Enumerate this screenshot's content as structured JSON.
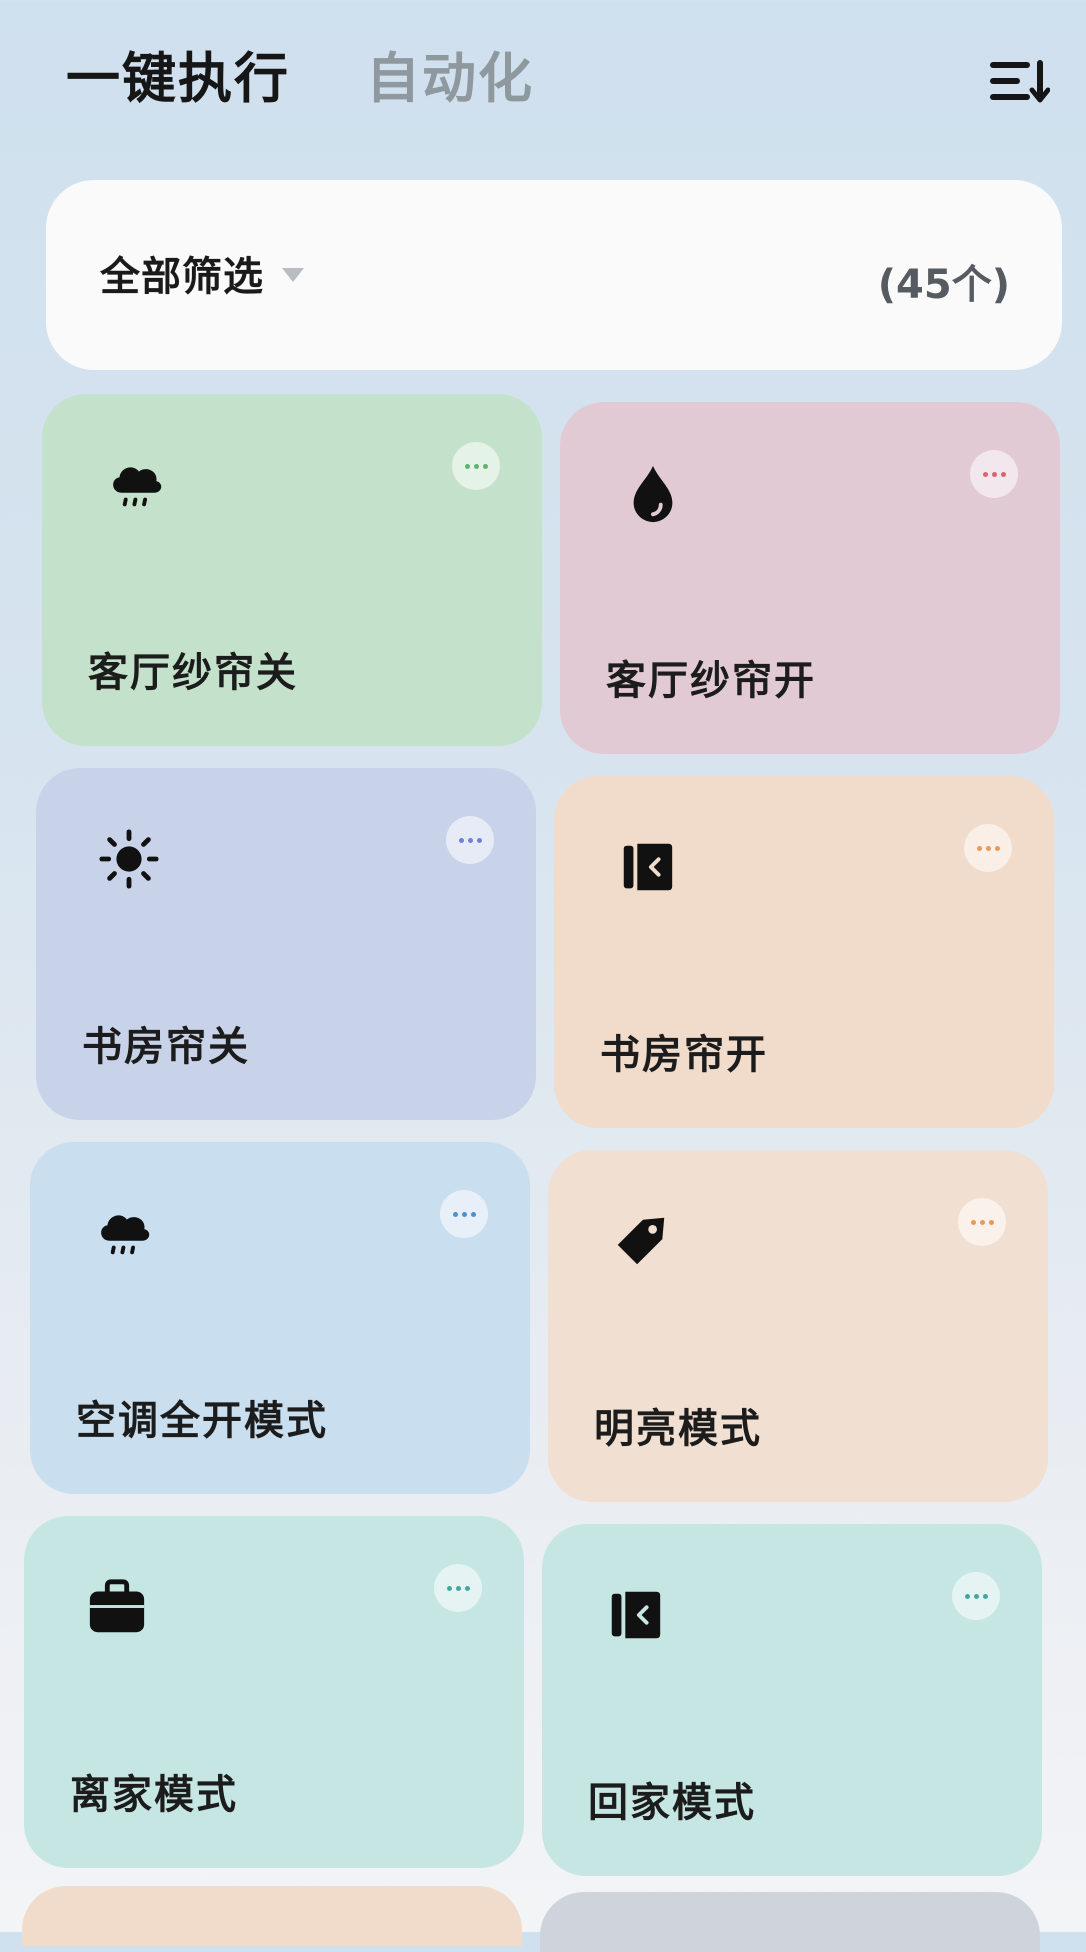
{
  "header": {
    "tabs": [
      {
        "label": "一键执行",
        "active": true
      },
      {
        "label": "自动化",
        "active": false
      }
    ],
    "menu_icon": "list-sort-icon"
  },
  "filter": {
    "label": "全部筛选",
    "count": "(45个)"
  },
  "colors": {
    "green_accent": "#5fb36a",
    "pink_accent": "#d9646f",
    "blue_accent": "#6a83d6",
    "orange_accent": "#e59a55",
    "sky_accent": "#4e8fd0",
    "teal_accent": "#3fa9a0"
  },
  "cards": [
    {
      "title": "客厅纱帘关",
      "icon": "rain-cloud-icon",
      "color": "green"
    },
    {
      "title": "客厅纱帘开",
      "icon": "water-drop-icon",
      "color": "pink"
    },
    {
      "title": "书房帘关",
      "icon": "sun-icon",
      "color": "blue"
    },
    {
      "title": "书房帘开",
      "icon": "door-exit-icon",
      "color": "peach"
    },
    {
      "title": "空调全开模式",
      "icon": "rain-cloud-icon",
      "color": "sky"
    },
    {
      "title": "明亮模式",
      "icon": "tag-icon",
      "color": "peach"
    },
    {
      "title": "离家模式",
      "icon": "briefcase-icon",
      "color": "mint"
    },
    {
      "title": "回家模式",
      "icon": "door-exit-icon",
      "color": "mint"
    }
  ]
}
